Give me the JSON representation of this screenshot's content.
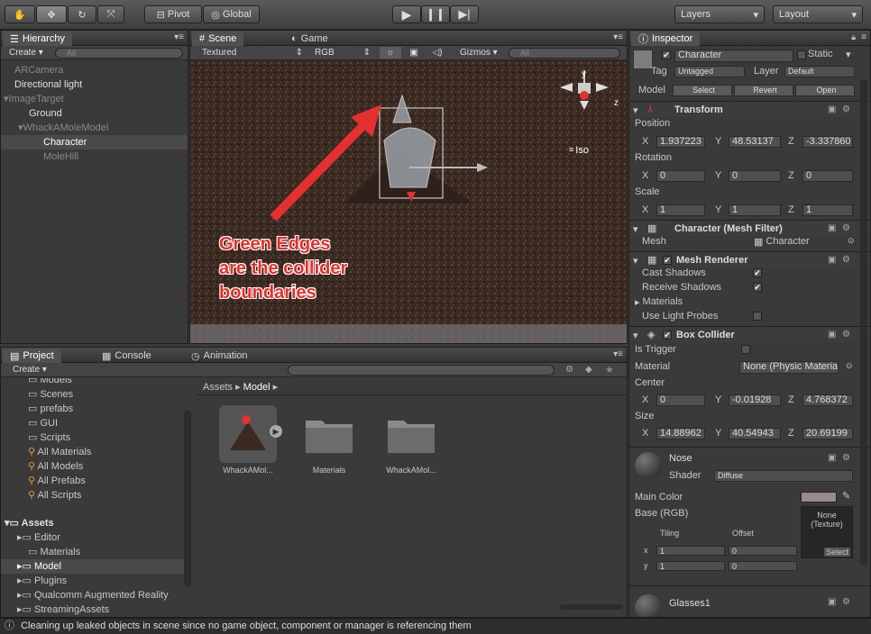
{
  "toolbar": {
    "pivot": "Pivot",
    "global": "Global",
    "layers": "Layers",
    "layout": "Layout"
  },
  "hierarchy": {
    "tab": "Hierarchy",
    "create": "Create",
    "search_placeholder": "All",
    "items": [
      "ARCamera",
      "Directional light",
      "ImageTarget",
      "Ground",
      "WhackAMoleModel",
      "Character",
      "MoleHill"
    ]
  },
  "scene": {
    "tab_scene": "Scene",
    "tab_game": "Game",
    "draw_mode": "Textured",
    "render_mode": "RGB",
    "gizmos": "Gizmos",
    "search_placeholder": "All",
    "gizmo_axis_y": "y",
    "gizmo_axis_z": "z",
    "iso": "Iso",
    "annotation": [
      "Green Edges",
      "are the collider",
      "boundaries"
    ]
  },
  "project": {
    "tab_project": "Project",
    "tab_console": "Console",
    "tab_animation": "Animation",
    "create": "Create",
    "tree_top": [
      "Models",
      "Scenes",
      "prefabs",
      "GUI",
      "Scripts",
      "All Materials",
      "All Models",
      "All Prefabs",
      "All Scripts"
    ],
    "assets_root": "Assets",
    "tree_assets": [
      "Editor",
      "Materials",
      "Model",
      "Plugins",
      "Qualcomm Augmented Reality",
      "StreamingAssets"
    ],
    "breadcrumb": [
      "Assets",
      "Model"
    ],
    "assets": [
      "WhackAMol...",
      "Materials",
      "WhackAMol..."
    ]
  },
  "inspector": {
    "tab": "Inspector",
    "object_name": "Character",
    "static": "Static",
    "tag_label": "Tag",
    "tag_value": "Untagged",
    "layer_label": "Layer",
    "layer_value": "Default",
    "model_label": "Model",
    "select": "Select",
    "revert": "Revert",
    "open": "Open",
    "transform": {
      "title": "Transform",
      "position": "Position",
      "rotation": "Rotation",
      "scale": "Scale",
      "pos": [
        "1.937223",
        "48.53137",
        "-3.337860"
      ],
      "rot": [
        "0",
        "0",
        "0"
      ],
      "scl": [
        "1",
        "1",
        "1"
      ]
    },
    "mesh_filter": {
      "title": "Character (Mesh Filter)",
      "mesh_label": "Mesh",
      "mesh_value": "Character"
    },
    "mesh_renderer": {
      "title": "Mesh Renderer",
      "cast": "Cast Shadows",
      "receive": "Receive Shadows",
      "materials": "Materials",
      "probes": "Use Light Probes"
    },
    "box_collider": {
      "title": "Box Collider",
      "trigger": "Is Trigger",
      "material": "Material",
      "material_value": "None (Physic Material)",
      "center": "Center",
      "size": "Size",
      "center_vals": [
        "0",
        "-0.01928",
        "4.768372"
      ],
      "size_vals": [
        "14.88962",
        "40.54943",
        "20.69199"
      ]
    },
    "nose": {
      "title": "Nose",
      "shader_label": "Shader",
      "shader_value": "Diffuse",
      "main_color": "Main Color",
      "base": "Base (RGB)",
      "tiling": "Tiling",
      "offset": "Offset",
      "none_texture": "None (Texture)",
      "select": "Select",
      "x": "x",
      "y": "y",
      "tx": "1",
      "ty": "1",
      "ox": "0",
      "oy": "0"
    },
    "glasses": {
      "title": "Glasses1"
    }
  },
  "xyz": [
    "X",
    "Y",
    "Z"
  ],
  "status": "Cleaning up leaked objects in scene since no game object, component or manager is referencing them"
}
